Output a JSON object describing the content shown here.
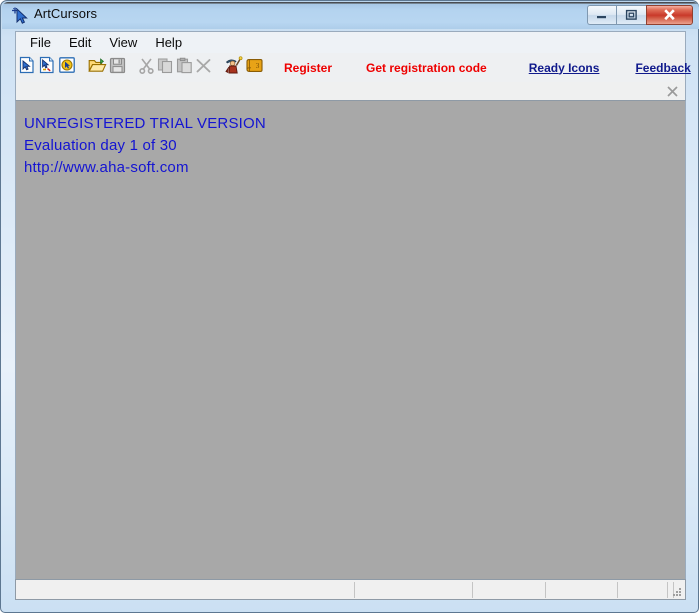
{
  "window": {
    "title": "ArtCursors",
    "icon": "cursor-move-icon",
    "controls": {
      "minimize_label": "–",
      "maximize_label": "❐",
      "close_label": "✕"
    }
  },
  "menubar": {
    "items": [
      {
        "label": "File",
        "name": "menu-file"
      },
      {
        "label": "Edit",
        "name": "menu-edit"
      },
      {
        "label": "View",
        "name": "menu-view"
      },
      {
        "label": "Help",
        "name": "menu-help"
      }
    ]
  },
  "toolbar": {
    "buttons": [
      {
        "name": "new-cursor-button",
        "icon": "new-cursor-icon",
        "enabled": true
      },
      {
        "name": "new-animated-cursor-button",
        "icon": "new-animated-cursor-icon",
        "enabled": true
      },
      {
        "name": "new-cursor-library-button",
        "icon": "new-cursor-library-icon",
        "enabled": true
      },
      {
        "name": "open-button",
        "icon": "open-folder-icon",
        "enabled": true
      },
      {
        "name": "save-button",
        "icon": "floppy-disk-icon",
        "enabled": false
      },
      {
        "name": "cut-button",
        "icon": "scissors-icon",
        "enabled": false
      },
      {
        "name": "copy-button",
        "icon": "copy-icon",
        "enabled": false
      },
      {
        "name": "paste-button",
        "icon": "paste-icon",
        "enabled": false
      },
      {
        "name": "delete-button",
        "icon": "x-delete-icon",
        "enabled": false
      },
      {
        "name": "wizard-button",
        "icon": "wizard-icon",
        "enabled": true
      },
      {
        "name": "help-book-button",
        "icon": "book-icon",
        "enabled": true
      }
    ],
    "links": [
      {
        "label": "Register",
        "name": "register-link",
        "style": "red"
      },
      {
        "label": "Get registration code",
        "name": "get-registration-code-link",
        "style": "red"
      },
      {
        "label": "Ready Icons",
        "name": "ready-icons-link",
        "style": "blue"
      },
      {
        "label": "Feedback",
        "name": "feedback-link",
        "style": "blue"
      }
    ]
  },
  "closebar": {
    "close_label": "✕"
  },
  "client": {
    "trial_line_1": "UNREGISTERED TRIAL VERSION",
    "trial_line_2": "Evaluation day 1 of 30",
    "trial_line_3": "http://www.aha-soft.com"
  },
  "statusbar": {
    "panels": [
      {
        "name": "status-panel-main",
        "text": ""
      },
      {
        "name": "status-panel-2",
        "text": ""
      },
      {
        "name": "status-panel-3",
        "text": ""
      },
      {
        "name": "status-panel-4",
        "text": ""
      },
      {
        "name": "status-panel-5",
        "text": ""
      },
      {
        "name": "status-panel-6",
        "text": ""
      }
    ]
  },
  "colors": {
    "title_bar": "#b4d3ef",
    "close_button": "#c9392a",
    "client_background": "#a8a8a8",
    "trial_text": "#1414d2",
    "register_text": "#ee0000",
    "link_text": "#101a8c"
  }
}
